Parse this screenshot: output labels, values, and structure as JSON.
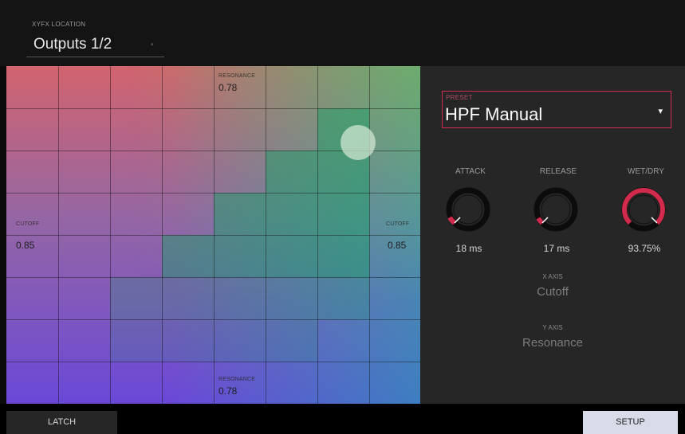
{
  "header": {
    "label": "XYFX LOCATION",
    "value": "Outputs 1/2"
  },
  "pad": {
    "top_label": "RESONANCE",
    "top_value": "0.78",
    "bottom_label": "RESONANCE",
    "bottom_value": "0.78",
    "left_label": "CUTOFF",
    "left_value": "0.85",
    "right_label": "CUTOFF",
    "right_value": "0.85"
  },
  "preset": {
    "label": "PRESET",
    "value": "HPF Manual"
  },
  "knobs": [
    {
      "label": "ATTACK",
      "value": "18 ms"
    },
    {
      "label": "RELEASE",
      "value": "17 ms"
    },
    {
      "label": "WET/DRY",
      "value": "93.75%"
    }
  ],
  "axes": {
    "x_label": "X AXIS",
    "x_value": "Cutoff",
    "y_label": "Y AXIS",
    "y_value": "Resonance"
  },
  "footer": {
    "latch": "LATCH",
    "setup": "SETUP"
  },
  "colors": {
    "accent": "#d02a4c",
    "panel": "#262626",
    "setup_button": "#d8dbe8"
  }
}
